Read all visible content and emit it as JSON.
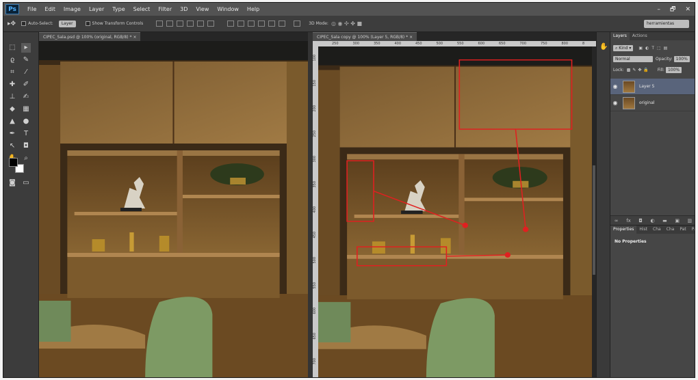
{
  "app": {
    "logo": "Ps",
    "menu": [
      "File",
      "Edit",
      "Image",
      "Layer",
      "Type",
      "Select",
      "Filter",
      "3D",
      "View",
      "Window",
      "Help"
    ],
    "window_controls": [
      "–",
      "🗗",
      "✕"
    ]
  },
  "options_bar": {
    "auto_select_label": "Auto-Select:",
    "auto_select_value": "Layer",
    "show_transform_label": "Show Transform Controls",
    "mode_3d_label": "3D Mode:",
    "workspace": "herramientas"
  },
  "documents": {
    "left_tab": "CIPEC_Sala.psd @ 100% (original, RGB/8) *",
    "right_tab": "CIPEC_Sala copy @ 100% (Layer 5, RGB/8) *",
    "ruler_top": [
      "250",
      "300",
      "350",
      "400",
      "450",
      "500",
      "550",
      "600",
      "650",
      "700",
      "750",
      "800",
      "8"
    ],
    "ruler_left": [
      "100",
      "150",
      "200",
      "250",
      "300",
      "350",
      "400",
      "450",
      "500",
      "550",
      "600",
      "650",
      "700"
    ]
  },
  "layers_panel": {
    "tabs": [
      "Layers",
      "Actions"
    ],
    "kind_label": "Kind",
    "blend_mode": "Normal",
    "opacity_label": "Opacity:",
    "opacity_value": "100%",
    "lock_label": "Lock:",
    "fill_label": "Fill:",
    "fill_value": "100%",
    "layers": [
      {
        "name": "Layer 5",
        "selected": true
      },
      {
        "name": "original",
        "selected": false
      }
    ]
  },
  "properties_panel": {
    "tabs": [
      "Properties",
      "Hist",
      "Cha",
      "Cha",
      "Pat",
      "Path"
    ],
    "text": "No Properties"
  },
  "colors": {
    "accent_selected_layer": "#59647b",
    "annotation_red": "#e02020"
  }
}
